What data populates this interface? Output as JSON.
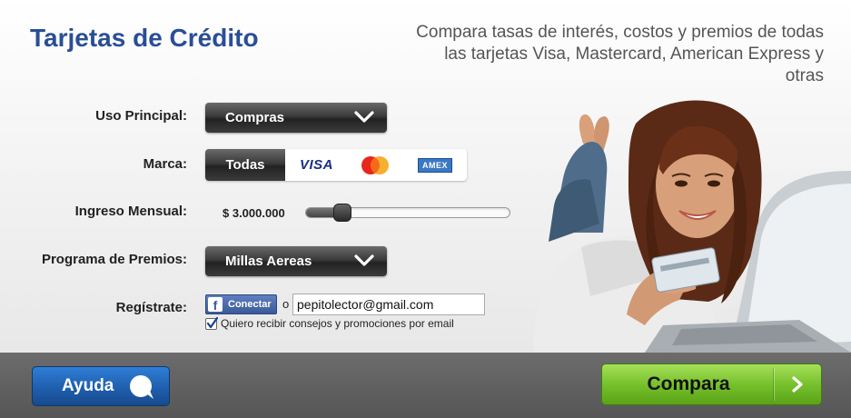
{
  "header": {
    "title": "Tarjetas de Crédito",
    "tagline": "Compara tasas de interés, costos y premios de todas las tarjetas Visa, Mastercard, American Express y otras"
  },
  "form": {
    "uso_principal": {
      "label": "Uso Principal:",
      "value": "Compras"
    },
    "marca": {
      "label": "Marca:",
      "all_label": "Todas",
      "brands": {
        "visa": "VISA",
        "mastercard": "mastercard-logo",
        "amex": "AMEX"
      }
    },
    "ingreso_mensual": {
      "label": "Ingreso Mensual:",
      "value": "$ 3.000.000",
      "slider_fraction": 0.18
    },
    "programa_premios": {
      "label": "Programa de Premios:",
      "value": "Millas Aereas"
    },
    "registrate": {
      "label": "Regístrate:",
      "facebook_label": "Conectar",
      "or_label": "o",
      "email_value": "pepitolector@gmail.com",
      "consent_label": "Quiero recibir consejos y promociones por email",
      "consent_checked": true
    }
  },
  "footer": {
    "help_label": "Ayuda",
    "compare_label": "Compara"
  },
  "colors": {
    "title": "#2a4e96",
    "help_button": "#1f5fae",
    "compare_button": "#77c12c",
    "facebook": "#3b5998"
  }
}
